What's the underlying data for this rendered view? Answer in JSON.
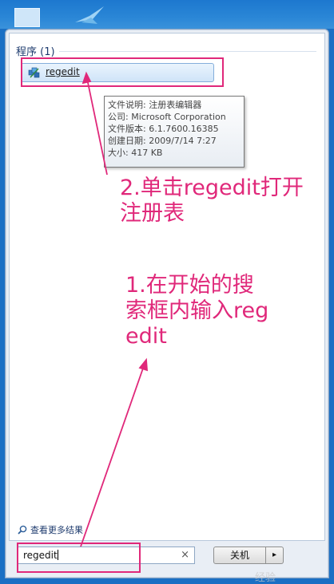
{
  "start_menu": {
    "section_header": "程序 (1)",
    "result": {
      "label": "regedit",
      "icon": "regedit-icon"
    },
    "tooltip": {
      "lines": [
        "文件说明: 注册表编辑器",
        "公司: Microsoft Corporation",
        "文件版本: 6.1.7600.16385",
        "创建日期: 2009/7/14 7:27",
        "大小: 417 KB"
      ]
    },
    "see_more": "查看更多结果",
    "search": {
      "value": "regedit",
      "clear_icon": "×"
    },
    "shutdown": {
      "label": "关机",
      "arrow": "▸"
    }
  },
  "annotations": {
    "step2_line1": "2.单击regedit打开",
    "step2_line2": "注册表",
    "step1_line1": "1.在开始的搜",
    "step1_line2": "索框内输入reg",
    "step1_line3": "edit",
    "color": "#e0287a"
  },
  "watermark": "经验"
}
